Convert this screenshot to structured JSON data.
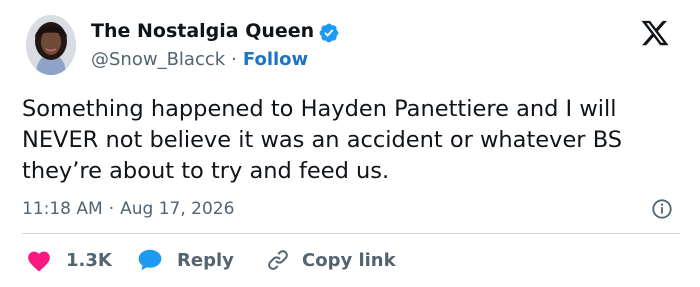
{
  "author": {
    "display_name": "The Nostalgia Queen",
    "handle": "@Snow_Blacck",
    "separator": "·",
    "follow_label": "Follow",
    "verified_color": "#1d9bf0"
  },
  "tweet": {
    "text": "Something happened to Hayden Panettiere and I will NEVER not believe it was an accident or whatever BS they’re about to try and feed us.",
    "time": "11:18 AM",
    "separator": "·",
    "date": "Aug 17, 2026"
  },
  "actions": {
    "like_count": "1.3K",
    "like_color": "#f91880",
    "reply_label": "Reply",
    "reply_color": "#1d9bf0",
    "copy_label": "Copy link"
  },
  "icons": {
    "avatar": "avatar-photo",
    "verified": "verified-badge-icon",
    "logo": "x-logo-icon",
    "info": "info-icon",
    "like": "heart-icon",
    "reply": "speech-bubble-icon",
    "copy": "link-icon"
  }
}
